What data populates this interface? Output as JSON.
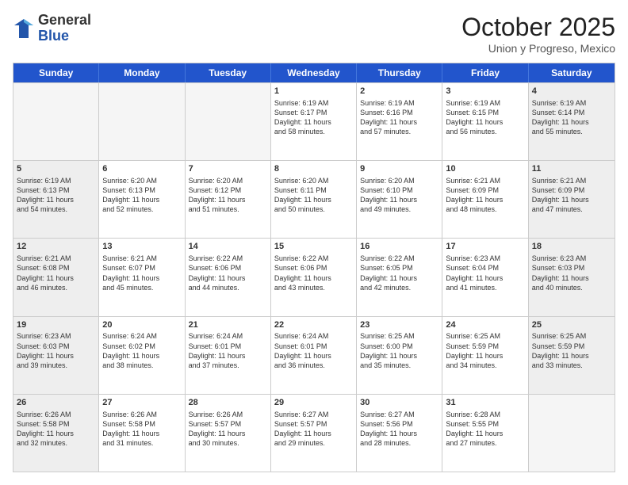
{
  "header": {
    "logo": {
      "general": "General",
      "blue": "Blue"
    },
    "title": "October 2025",
    "subtitle": "Union y Progreso, Mexico"
  },
  "weekdays": [
    "Sunday",
    "Monday",
    "Tuesday",
    "Wednesday",
    "Thursday",
    "Friday",
    "Saturday"
  ],
  "rows": [
    [
      {
        "day": "",
        "text": "",
        "empty": true
      },
      {
        "day": "",
        "text": "",
        "empty": true
      },
      {
        "day": "",
        "text": "",
        "empty": true
      },
      {
        "day": "1",
        "text": "Sunrise: 6:19 AM\nSunset: 6:17 PM\nDaylight: 11 hours\nand 58 minutes.",
        "empty": false
      },
      {
        "day": "2",
        "text": "Sunrise: 6:19 AM\nSunset: 6:16 PM\nDaylight: 11 hours\nand 57 minutes.",
        "empty": false
      },
      {
        "day": "3",
        "text": "Sunrise: 6:19 AM\nSunset: 6:15 PM\nDaylight: 11 hours\nand 56 minutes.",
        "empty": false
      },
      {
        "day": "4",
        "text": "Sunrise: 6:19 AM\nSunset: 6:14 PM\nDaylight: 11 hours\nand 55 minutes.",
        "empty": false,
        "shaded": true
      }
    ],
    [
      {
        "day": "5",
        "text": "Sunrise: 6:19 AM\nSunset: 6:13 PM\nDaylight: 11 hours\nand 54 minutes.",
        "empty": false,
        "shaded": true
      },
      {
        "day": "6",
        "text": "Sunrise: 6:20 AM\nSunset: 6:13 PM\nDaylight: 11 hours\nand 52 minutes.",
        "empty": false
      },
      {
        "day": "7",
        "text": "Sunrise: 6:20 AM\nSunset: 6:12 PM\nDaylight: 11 hours\nand 51 minutes.",
        "empty": false
      },
      {
        "day": "8",
        "text": "Sunrise: 6:20 AM\nSunset: 6:11 PM\nDaylight: 11 hours\nand 50 minutes.",
        "empty": false
      },
      {
        "day": "9",
        "text": "Sunrise: 6:20 AM\nSunset: 6:10 PM\nDaylight: 11 hours\nand 49 minutes.",
        "empty": false
      },
      {
        "day": "10",
        "text": "Sunrise: 6:21 AM\nSunset: 6:09 PM\nDaylight: 11 hours\nand 48 minutes.",
        "empty": false
      },
      {
        "day": "11",
        "text": "Sunrise: 6:21 AM\nSunset: 6:09 PM\nDaylight: 11 hours\nand 47 minutes.",
        "empty": false,
        "shaded": true
      }
    ],
    [
      {
        "day": "12",
        "text": "Sunrise: 6:21 AM\nSunset: 6:08 PM\nDaylight: 11 hours\nand 46 minutes.",
        "empty": false,
        "shaded": true
      },
      {
        "day": "13",
        "text": "Sunrise: 6:21 AM\nSunset: 6:07 PM\nDaylight: 11 hours\nand 45 minutes.",
        "empty": false
      },
      {
        "day": "14",
        "text": "Sunrise: 6:22 AM\nSunset: 6:06 PM\nDaylight: 11 hours\nand 44 minutes.",
        "empty": false
      },
      {
        "day": "15",
        "text": "Sunrise: 6:22 AM\nSunset: 6:06 PM\nDaylight: 11 hours\nand 43 minutes.",
        "empty": false
      },
      {
        "day": "16",
        "text": "Sunrise: 6:22 AM\nSunset: 6:05 PM\nDaylight: 11 hours\nand 42 minutes.",
        "empty": false
      },
      {
        "day": "17",
        "text": "Sunrise: 6:23 AM\nSunset: 6:04 PM\nDaylight: 11 hours\nand 41 minutes.",
        "empty": false
      },
      {
        "day": "18",
        "text": "Sunrise: 6:23 AM\nSunset: 6:03 PM\nDaylight: 11 hours\nand 40 minutes.",
        "empty": false,
        "shaded": true
      }
    ],
    [
      {
        "day": "19",
        "text": "Sunrise: 6:23 AM\nSunset: 6:03 PM\nDaylight: 11 hours\nand 39 minutes.",
        "empty": false,
        "shaded": true
      },
      {
        "day": "20",
        "text": "Sunrise: 6:24 AM\nSunset: 6:02 PM\nDaylight: 11 hours\nand 38 minutes.",
        "empty": false
      },
      {
        "day": "21",
        "text": "Sunrise: 6:24 AM\nSunset: 6:01 PM\nDaylight: 11 hours\nand 37 minutes.",
        "empty": false
      },
      {
        "day": "22",
        "text": "Sunrise: 6:24 AM\nSunset: 6:01 PM\nDaylight: 11 hours\nand 36 minutes.",
        "empty": false
      },
      {
        "day": "23",
        "text": "Sunrise: 6:25 AM\nSunset: 6:00 PM\nDaylight: 11 hours\nand 35 minutes.",
        "empty": false
      },
      {
        "day": "24",
        "text": "Sunrise: 6:25 AM\nSunset: 5:59 PM\nDaylight: 11 hours\nand 34 minutes.",
        "empty": false
      },
      {
        "day": "25",
        "text": "Sunrise: 6:25 AM\nSunset: 5:59 PM\nDaylight: 11 hours\nand 33 minutes.",
        "empty": false,
        "shaded": true
      }
    ],
    [
      {
        "day": "26",
        "text": "Sunrise: 6:26 AM\nSunset: 5:58 PM\nDaylight: 11 hours\nand 32 minutes.",
        "empty": false,
        "shaded": true
      },
      {
        "day": "27",
        "text": "Sunrise: 6:26 AM\nSunset: 5:58 PM\nDaylight: 11 hours\nand 31 minutes.",
        "empty": false
      },
      {
        "day": "28",
        "text": "Sunrise: 6:26 AM\nSunset: 5:57 PM\nDaylight: 11 hours\nand 30 minutes.",
        "empty": false
      },
      {
        "day": "29",
        "text": "Sunrise: 6:27 AM\nSunset: 5:57 PM\nDaylight: 11 hours\nand 29 minutes.",
        "empty": false
      },
      {
        "day": "30",
        "text": "Sunrise: 6:27 AM\nSunset: 5:56 PM\nDaylight: 11 hours\nand 28 minutes.",
        "empty": false
      },
      {
        "day": "31",
        "text": "Sunrise: 6:28 AM\nSunset: 5:55 PM\nDaylight: 11 hours\nand 27 minutes.",
        "empty": false
      },
      {
        "day": "",
        "text": "",
        "empty": true,
        "shaded": true
      }
    ]
  ]
}
